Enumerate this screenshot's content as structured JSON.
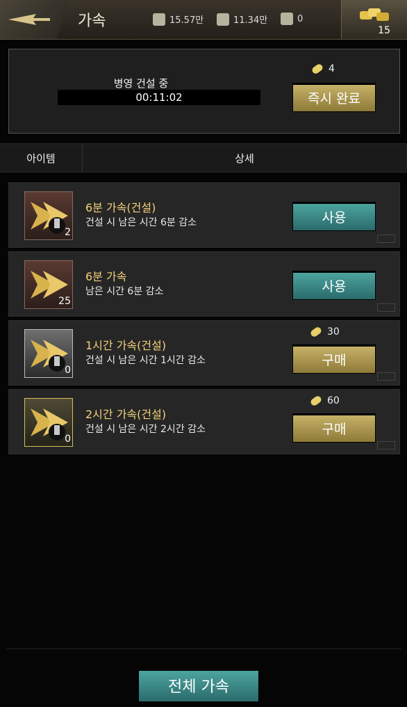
{
  "header": {
    "title": "가속",
    "resources": [
      {
        "icon": "grain-icon",
        "value": "15.57만"
      },
      {
        "icon": "coin-icon",
        "value": "11.34만"
      },
      {
        "icon": "wood-icon",
        "value": "0"
      }
    ],
    "gold_count": "15"
  },
  "build": {
    "label": "병영 건설 중",
    "timer": "00:11:02",
    "cost": "4",
    "instant_label": "즉시 완료"
  },
  "tabs": {
    "item": "아이템",
    "detail": "상세"
  },
  "items": [
    {
      "title": "6분 가속(건설)",
      "desc": "건설 시 남은 시간 6분 감소",
      "count": "2",
      "button": "사용",
      "cost": ""
    },
    {
      "title": "6분 가속",
      "desc": "남은 시간 6분 감소",
      "count": "25",
      "button": "사용",
      "cost": ""
    },
    {
      "title": "1시간 가속(건설)",
      "desc": "건설 시 남은 시간 1시간 감소",
      "count": "0",
      "button": "구매",
      "cost": "30"
    },
    {
      "title": "2시간 가속(건설)",
      "desc": "건설 시 남은 시간 2시간 감소",
      "count": "0",
      "button": "구매",
      "cost": "60"
    }
  ],
  "bottom": {
    "all_speed_label": "전체 가속"
  },
  "colors": {
    "accent_gold": "#c8b46a",
    "accent_teal": "#2a6b6c",
    "item_title": "#f3d27a"
  }
}
